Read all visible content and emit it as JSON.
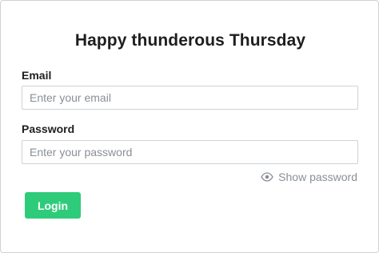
{
  "page": {
    "title": "Happy thunderous Thursday"
  },
  "form": {
    "email": {
      "label": "Email",
      "placeholder": "Enter your email",
      "value": ""
    },
    "password": {
      "label": "Password",
      "placeholder": "Enter your password",
      "value": ""
    },
    "show_password": {
      "label": "Show password",
      "icon": "eye-icon"
    },
    "submit": {
      "label": "Login"
    }
  },
  "colors": {
    "accent": "#2ecc7a",
    "text": "#1e1e1e",
    "muted": "#8a8f96",
    "border": "#cfd3d8"
  }
}
